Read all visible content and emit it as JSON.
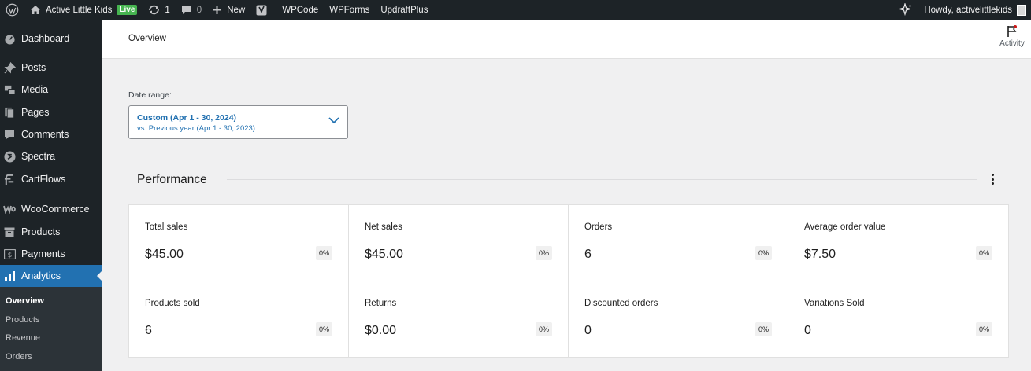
{
  "adminbar": {
    "site_name": "Active Little Kids",
    "live_badge": "Live",
    "updates_count": "1",
    "comments_count": "0",
    "new_label": "New",
    "links": [
      "WPCode",
      "WPForms",
      "UpdraftPlus"
    ],
    "howdy": "Howdy, activelittlekids"
  },
  "sidebar": {
    "items": [
      {
        "label": "Dashboard",
        "icon": "dashboard-icon"
      },
      {
        "label": "Posts",
        "icon": "pin-icon"
      },
      {
        "label": "Media",
        "icon": "media-icon"
      },
      {
        "label": "Pages",
        "icon": "pages-icon"
      },
      {
        "label": "Comments",
        "icon": "comments-icon"
      },
      {
        "label": "Spectra",
        "icon": "spectra-icon"
      },
      {
        "label": "CartFlows",
        "icon": "cartflows-icon"
      },
      {
        "label": "WooCommerce",
        "icon": "woocommerce-icon"
      },
      {
        "label": "Products",
        "icon": "archive-icon"
      },
      {
        "label": "Payments",
        "icon": "payments-icon"
      },
      {
        "label": "Analytics",
        "icon": "bar-chart-icon"
      }
    ],
    "submenu": [
      "Overview",
      "Products",
      "Revenue",
      "Orders"
    ]
  },
  "header": {
    "title": "Overview",
    "activity_label": "Activity"
  },
  "date_range": {
    "label": "Date range:",
    "primary": "Custom (Apr 1 - 30, 2024)",
    "secondary": "vs. Previous year (Apr 1 - 30, 2023)"
  },
  "performance": {
    "title": "Performance",
    "metrics": [
      {
        "label": "Total sales",
        "value": "$45.00",
        "delta": "0%"
      },
      {
        "label": "Net sales",
        "value": "$45.00",
        "delta": "0%"
      },
      {
        "label": "Orders",
        "value": "6",
        "delta": "0%"
      },
      {
        "label": "Average order value",
        "value": "$7.50",
        "delta": "0%"
      },
      {
        "label": "Products sold",
        "value": "6",
        "delta": "0%"
      },
      {
        "label": "Returns",
        "value": "$0.00",
        "delta": "0%"
      },
      {
        "label": "Discounted orders",
        "value": "0",
        "delta": "0%"
      },
      {
        "label": "Variations Sold",
        "value": "0",
        "delta": "0%"
      }
    ]
  },
  "colors": {
    "adminbar_bg": "#1d2327",
    "accent": "#2271b1",
    "live_badge": "#46b450"
  }
}
